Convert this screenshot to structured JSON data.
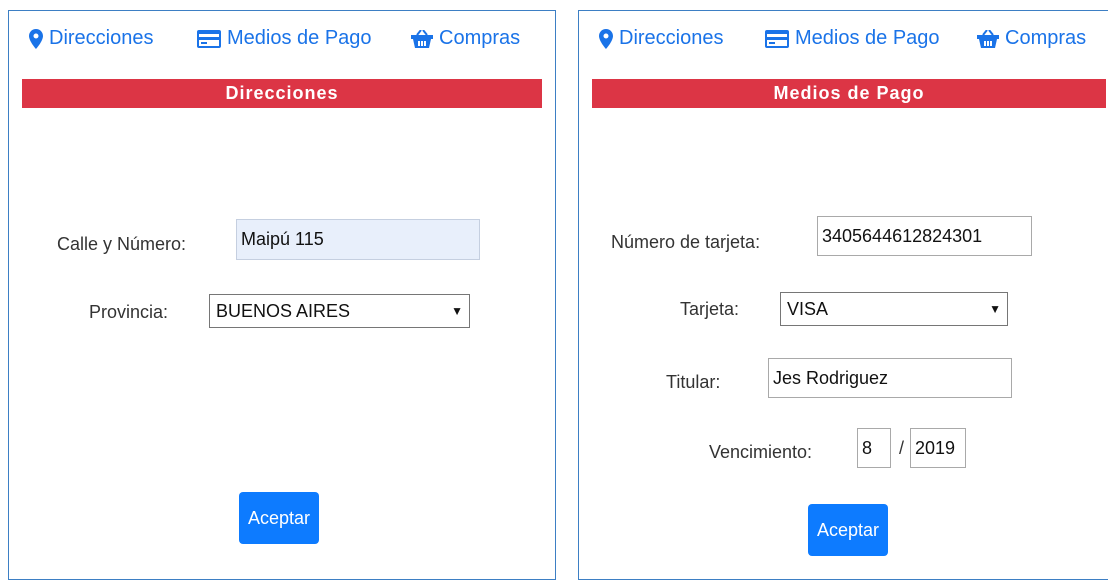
{
  "nav": {
    "direcciones": "Direcciones",
    "medios_pago": "Medios de Pago",
    "compras": "Compras",
    "icons": [
      "map-marker-icon",
      "credit-card-icon",
      "basket-icon"
    ],
    "color": "#1a73e8"
  },
  "left": {
    "header": "Direcciones",
    "calle_label": "Calle y Número:",
    "calle_value": "Maipú 115",
    "provincia_label": "Provincia:",
    "provincia_value": "BUENOS AIRES",
    "aceptar": "Aceptar"
  },
  "right": {
    "header": "Medios de Pago",
    "numero_label": "Número de tarjeta:",
    "numero_value": "3405644612824301",
    "tarjeta_label": "Tarjeta:",
    "tarjeta_value": "VISA",
    "titular_label": "Titular:",
    "titular_value": "Jes Rodriguez",
    "vencimiento_label": "Vencimiento:",
    "mes_value": "8",
    "separator": "/",
    "anio_value": "2019",
    "aceptar": "Aceptar"
  },
  "colors": {
    "header_bar": "#dc3545",
    "primary_button": "#0d7bff",
    "panel_border": "#3d7fc4"
  }
}
